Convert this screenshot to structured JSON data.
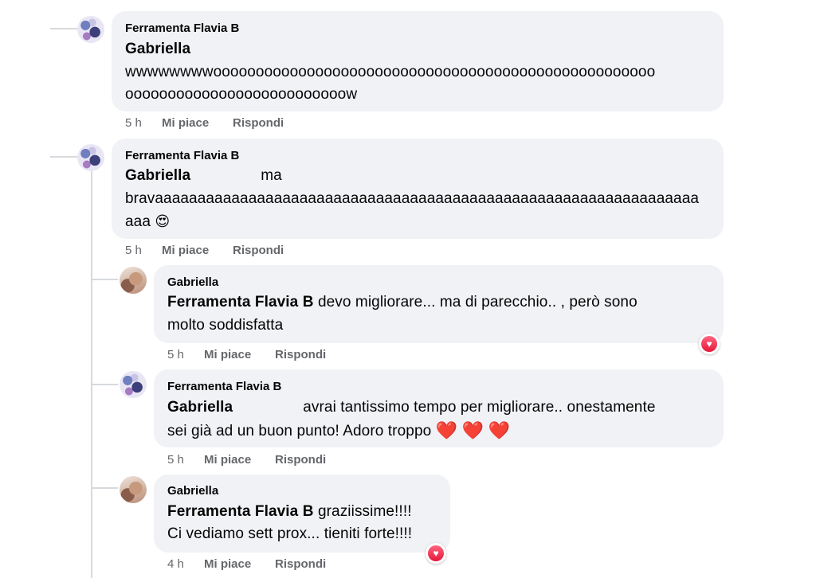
{
  "comments": [
    {
      "author": "Ferramenta Flavia B",
      "tag": "Gabriella",
      "lines": [
        "wwwwwwwwoooooooooooooooooooooooooooooooooooooooooooooooooooo",
        "oooooooooooooooooooooooooow"
      ],
      "time": "5 h",
      "like": "Mi piace",
      "reply": "Rispondi"
    },
    {
      "author": "Ferramenta Flavia B",
      "tag": "Gabriella",
      "first_text": "ma",
      "lines": [
        "bravaaaaaaaaaaaaaaaaaaaaaaaaaaaaaaaaaaaaaaaaaaaaaaaaaaaaaaaaaaaaaaaa",
        "aaa"
      ],
      "emoji": "😍",
      "time": "5 h",
      "like": "Mi piace",
      "reply": "Rispondi"
    },
    {
      "author": "Gabriella",
      "tag": "Ferramenta Flavia B",
      "first_text": "devo migliorare... ma di parecchio.. , però sono",
      "lines": [
        "molto soddisfatta"
      ],
      "reaction": "heart-reaction-icon",
      "time": "5 h",
      "like": "Mi piace",
      "reply": "Rispondi"
    },
    {
      "author": "Ferramenta Flavia B",
      "tag": "Gabriella",
      "first_text": "avrai tantissimo tempo per migliorare.. onestamente",
      "lines": [
        "sei già ad un buon punto! Adoro troppo"
      ],
      "hearts": "❤️",
      "time": "5 h",
      "like": "Mi piace",
      "reply": "Rispondi"
    },
    {
      "author": "Gabriella",
      "tag": "Ferramenta Flavia B",
      "first_text": "graziissime!!!!",
      "lines": [
        "Ci vediamo sett prox... tieniti forte!!!!"
      ],
      "reaction": "heart-reaction-icon",
      "time": "4 h",
      "like": "Mi piace",
      "reply": "Rispondi"
    }
  ],
  "colors": {
    "bubble": "#f0f2f5",
    "meta": "#65676b",
    "heart": "#e41e3f"
  }
}
